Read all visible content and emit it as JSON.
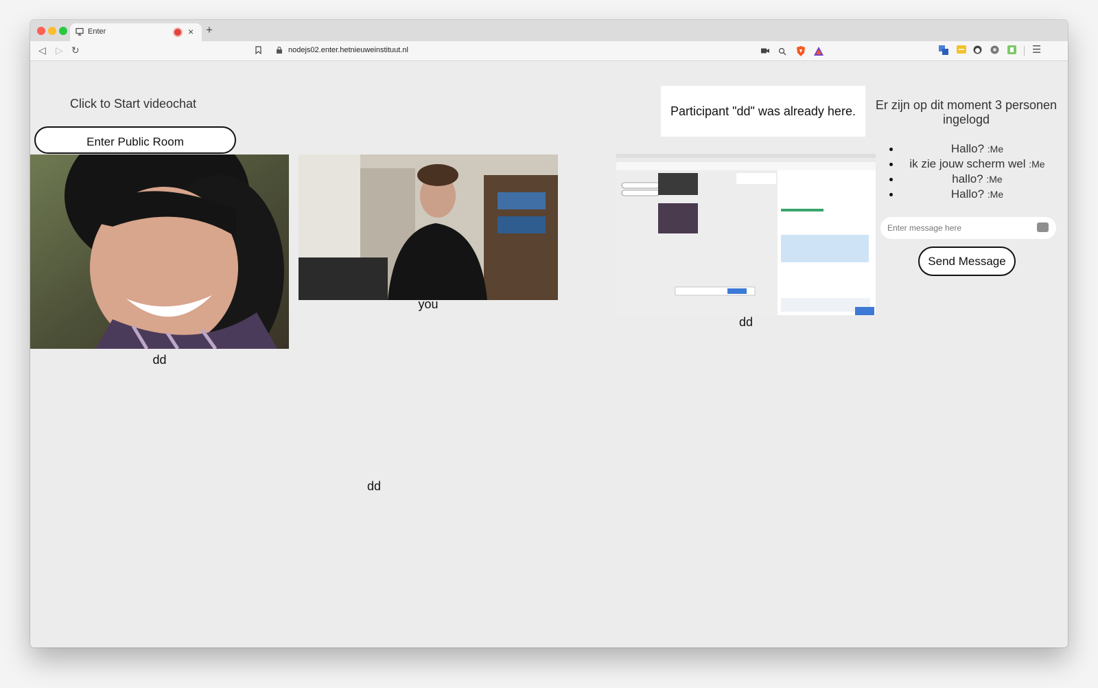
{
  "browser": {
    "tab_title": "Enter",
    "url": "nodejs02.enter.hetnieuweinstituut.nl"
  },
  "page": {
    "start_label": "Click to Start videochat",
    "enter_button": "Enter Public Room",
    "notice": "Participant \"dd\" was already here.",
    "online_text": "Er zijn op dit moment 3 personen ingelogd",
    "videos": [
      {
        "label": "dd"
      },
      {
        "label": "you"
      },
      {
        "label": "dd"
      },
      {
        "label": "dd"
      }
    ],
    "messages": [
      {
        "text": "Hallo?",
        "author": ":Me"
      },
      {
        "text": "ik zie jouw scherm wel",
        "author": ":Me"
      },
      {
        "text": "hallo?",
        "author": ":Me"
      },
      {
        "text": "Hallo?",
        "author": ":Me"
      }
    ],
    "message_placeholder": "Enter message here",
    "send_button": "Send Message"
  }
}
